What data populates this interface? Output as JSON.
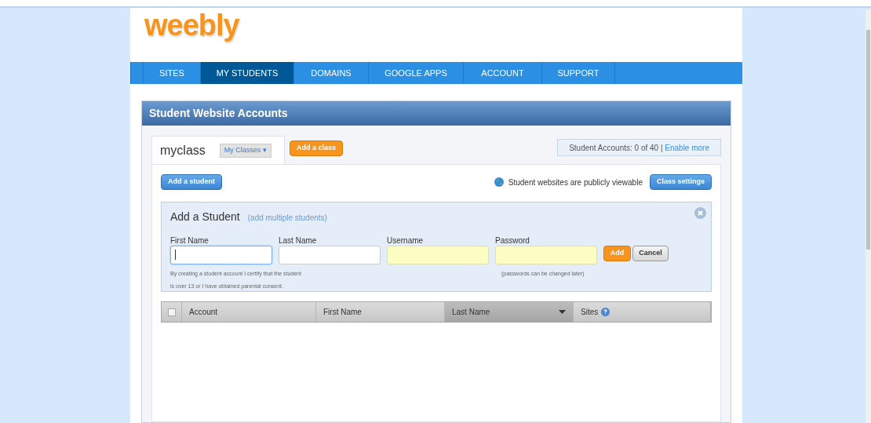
{
  "logo": {
    "text": "weebly"
  },
  "nav": [
    {
      "label": "SITES",
      "selected": false
    },
    {
      "label": "MY STUDENTS",
      "selected": true
    },
    {
      "label": "DOMAINS",
      "selected": false
    },
    {
      "label": "GOOGLE APPS",
      "selected": false
    },
    {
      "label": "ACCOUNT",
      "selected": false
    },
    {
      "label": "SUPPORT",
      "selected": false
    }
  ],
  "panel": {
    "title": "Student Website Accounts"
  },
  "class_tab": {
    "name": "myclass",
    "dropdown": "My Classes ▾",
    "add_button": "Add a class"
  },
  "accounts": {
    "text": "Student Accounts: 0 of 40 |",
    "link": "Enable more"
  },
  "toolbar": {
    "add_student": "Add a student",
    "visibility": "Student websites are publicly viewable",
    "settings": "Class settings"
  },
  "add_form": {
    "title": "Add a Student",
    "multiple_link": "(add multiple students)",
    "fields": [
      {
        "label": "First Name",
        "kind": "plain",
        "focused": true
      },
      {
        "label": "Last Name",
        "kind": "plain",
        "focused": false
      },
      {
        "label": "Username",
        "kind": "required",
        "focused": false
      },
      {
        "label": "Password",
        "kind": "required",
        "focused": false
      }
    ],
    "certify_note": [
      "By creating a student account I certify that the student",
      "is over 13 or I have obtained parental consent."
    ],
    "password_note": "(passwords can be changed later)",
    "add": "Add",
    "cancel": "Cancel"
  },
  "table": {
    "select_all_checked": false,
    "columns": [
      {
        "label": "Account",
        "sorted": false,
        "help": false
      },
      {
        "label": "First Name",
        "sorted": false,
        "help": false
      },
      {
        "label": "Last Name",
        "sorted": true,
        "help": false
      },
      {
        "label": "Sites",
        "sorted": false,
        "help": true
      }
    ]
  }
}
